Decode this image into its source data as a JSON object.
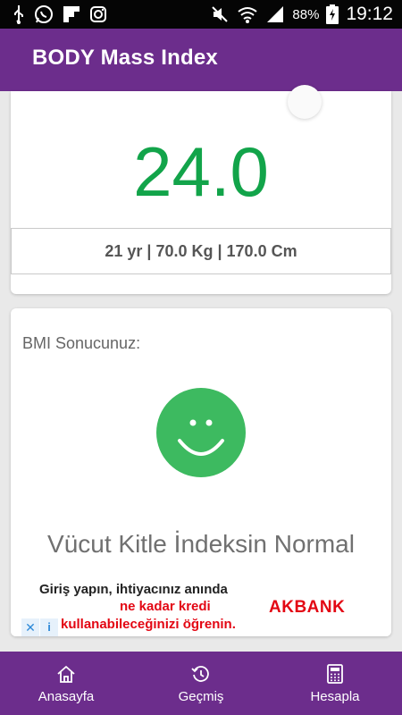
{
  "status_bar": {
    "battery": "88%",
    "time": "19:12"
  },
  "app_bar": {
    "title": "BODY Mass Index"
  },
  "result_card": {
    "bmi_value": "24.0",
    "bmi_color": "#12a44a",
    "stats": "21 yr | 70.0 Kg | 170.0 Cm"
  },
  "result_detail": {
    "label": "BMI Sonucunuz:",
    "icon": "smiley-face-icon",
    "icon_color": "#3dba60",
    "message": "Vücut Kitle İndeksin Normal"
  },
  "ad": {
    "line1": "Giriş yapın, ihtiyacınız anında",
    "line2": "ne kadar kredi",
    "line3": "kullanabileceğinizi öğrenin.",
    "brand": "AKBANK",
    "close": "✕",
    "info": "i"
  },
  "bottom_nav": {
    "items": [
      {
        "label": "Anasayfa",
        "icon": "home-icon"
      },
      {
        "label": "Geçmiş",
        "icon": "history-icon"
      },
      {
        "label": "Hesapla",
        "icon": "calculator-icon"
      }
    ]
  },
  "colors": {
    "primary": "#6c2d8c",
    "accent_green": "#12a44a",
    "ad_red": "#e30613"
  }
}
